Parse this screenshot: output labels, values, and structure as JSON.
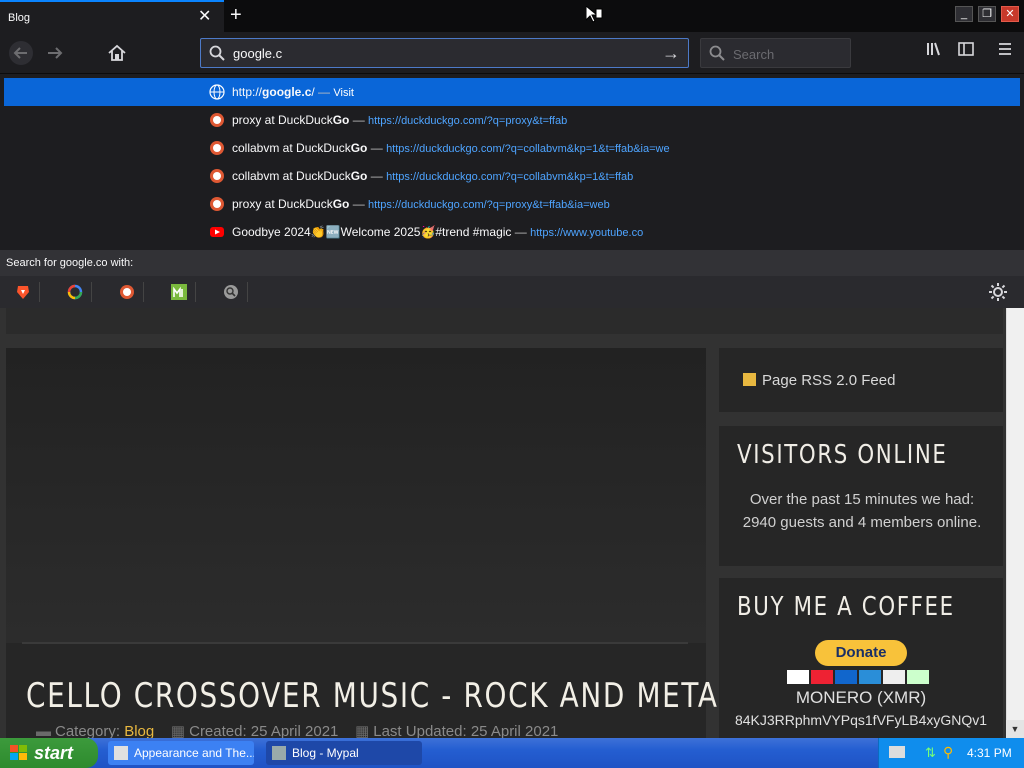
{
  "browser": {
    "tab_title": "Blog",
    "url_value": "google.c",
    "search_placeholder": "Search"
  },
  "dropdown": {
    "rows": [
      {
        "title_pre": "http://",
        "title_bold": "google.c",
        "title_post": "/",
        "sep": " — ",
        "url": "Visit"
      },
      {
        "title_pre": "proxy at DuckDuck",
        "title_bold": "Go",
        "title_post": "",
        "sep": " — ",
        "url": "https://duckduckgo.com/?q=proxy&t=ffab"
      },
      {
        "title_pre": "collabvm at DuckDuck",
        "title_bold": "Go",
        "title_post": "",
        "sep": " — ",
        "url": "https://duckduckgo.com/?q=collabvm&kp=1&t=ffab&ia=we"
      },
      {
        "title_pre": "collabvm at DuckDuck",
        "title_bold": "Go",
        "title_post": "",
        "sep": " — ",
        "url": "https://duckduckgo.com/?q=collabvm&kp=1&t=ffab"
      },
      {
        "title_pre": "proxy at DuckDuck",
        "title_bold": "Go",
        "title_post": "",
        "sep": " — ",
        "url": "https://duckduckgo.com/?q=proxy&t=ffab&ia=web"
      },
      {
        "title_pre": "Goodbye 2024👏🆕Welcome 2025🥳#trend #magic",
        "title_bold": "",
        "title_post": "",
        "sep": " — ",
        "url": "https://www.youtube.co"
      }
    ],
    "search_with_label": "Search for google.co with:"
  },
  "page": {
    "rss_label": "Page RSS 2.0 Feed",
    "visitors_title": "VISITORS ONLINE",
    "visitors_text": "Over the past 15 minutes we had: 2940 guests and 4 members online.",
    "coffee_title": "BUY ME A COFFEE",
    "donate_label": "Donate",
    "xmr_label": "MONERO (XMR)",
    "xmr_address": "84KJ3RRphmVYPqs1fVFyLB4xyGNQv1",
    "article_title": "CELLO CROSSOVER MUSIC - ROCK AND METAL",
    "category_label": "Category:",
    "category_value": "Blog",
    "created": "Created: 25 April 2021",
    "updated": "Last Updated: 25 April 2021"
  },
  "taskbar": {
    "start_label": "start",
    "task1": "Appearance and The...",
    "task2": "Blog - Mypal",
    "clock": "4:31 PM"
  },
  "colors": {
    "accent": "#0a84ff",
    "link": "#4ea4ff",
    "gold": "#e8b840"
  }
}
